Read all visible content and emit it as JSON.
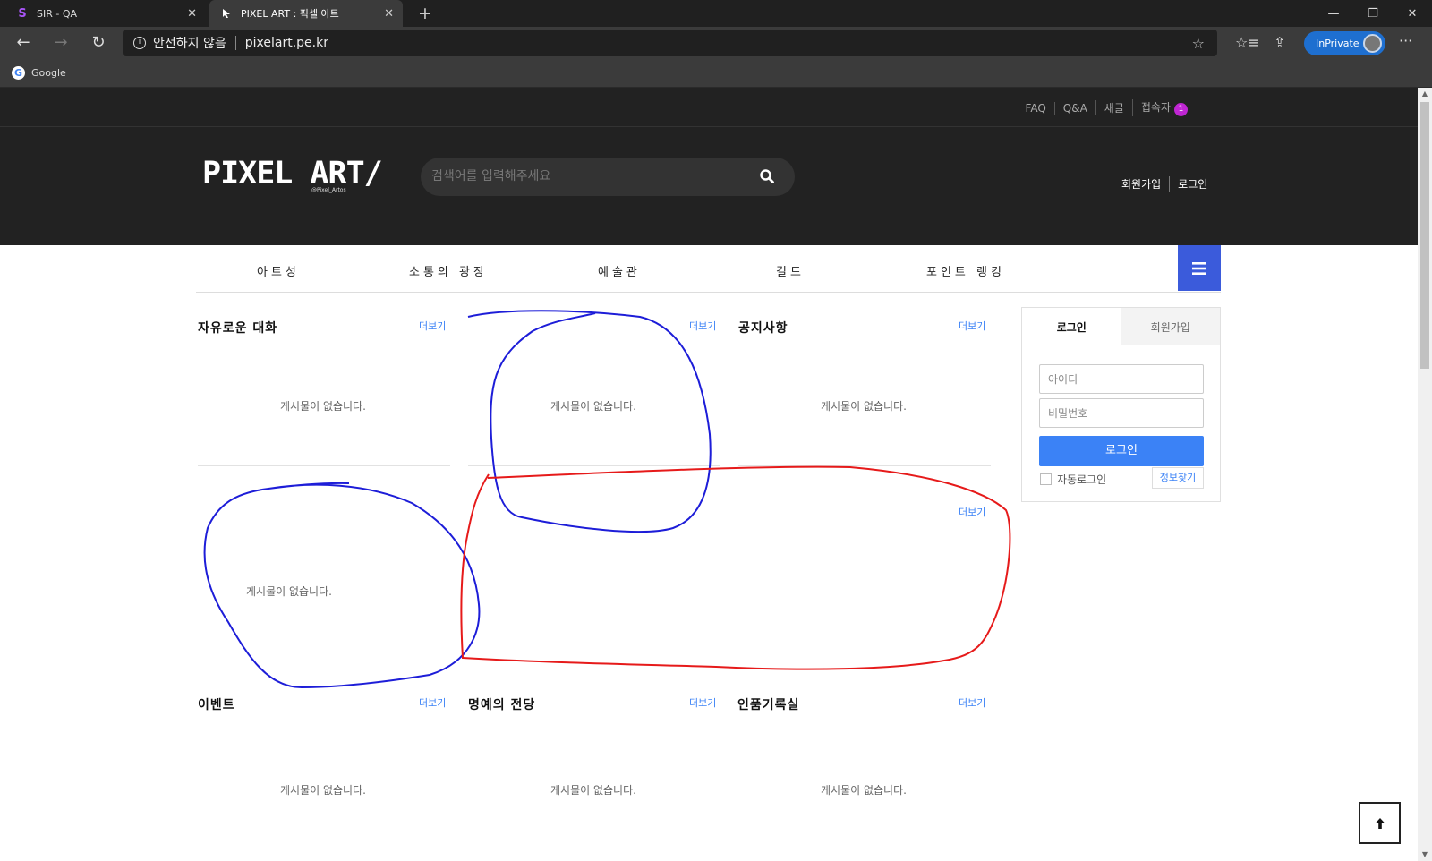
{
  "browser": {
    "tabs": [
      {
        "title": "SIR - QA",
        "icon": "S"
      },
      {
        "title": "PIXEL ART : 픽셀 아트",
        "icon": "cursor"
      }
    ],
    "new_tab": "+",
    "window": {
      "minimize": "—",
      "restore": "❐",
      "close": "✕"
    },
    "address": {
      "security_label": "안전하지 않음",
      "url": "pixelart.pe.kr"
    },
    "inprivate_label": "InPrivate",
    "more_label": "···",
    "bookmarks": [
      {
        "label": "Google"
      }
    ]
  },
  "site": {
    "top_links": [
      "FAQ",
      "Q&A",
      "새글",
      "접속자"
    ],
    "visitor_count": "1",
    "logo": {
      "text": "PIXEL ART/",
      "sub": "@Pixel_Artos"
    },
    "search": {
      "placeholder": "검색어를 입력해주세요"
    },
    "auth_links": [
      "회원가입",
      "로그인"
    ],
    "nav": [
      "아트성",
      "소통의 광장",
      "예술관",
      "길드",
      "포인트 랭킹"
    ],
    "more_label": "더보기",
    "empty_text": "게시물이 없습니다.",
    "boards": [
      {
        "title": "자유로운 대화"
      },
      {
        "title": ""
      },
      {
        "title": "공지사항"
      },
      {
        "title": ""
      },
      {
        "title": ""
      },
      {
        "title": "이벤트"
      },
      {
        "title": "명예의 전당"
      },
      {
        "title": "인품기록실"
      }
    ],
    "login": {
      "tabs": [
        "로그인",
        "회원가입"
      ],
      "id_placeholder": "아이디",
      "pw_placeholder": "비밀번호",
      "button": "로그인",
      "auto_login": "자동로그인",
      "find_info": "정보찾기"
    }
  },
  "colors": {
    "accent": "#3b82f6",
    "menu_button": "#3b5bdb",
    "badge": "#c026d3",
    "header_bg": "#222222"
  }
}
